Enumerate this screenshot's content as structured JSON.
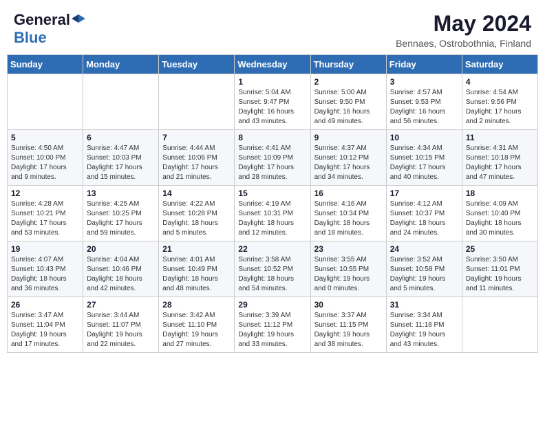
{
  "header": {
    "logo_general": "General",
    "logo_blue": "Blue",
    "title": "May 2024",
    "location": "Bennaes, Ostrobothnia, Finland"
  },
  "days_of_week": [
    "Sunday",
    "Monday",
    "Tuesday",
    "Wednesday",
    "Thursday",
    "Friday",
    "Saturday"
  ],
  "weeks": [
    [
      {
        "day": "",
        "info": ""
      },
      {
        "day": "",
        "info": ""
      },
      {
        "day": "",
        "info": ""
      },
      {
        "day": "1",
        "info": "Sunrise: 5:04 AM\nSunset: 9:47 PM\nDaylight: 16 hours\nand 43 minutes."
      },
      {
        "day": "2",
        "info": "Sunrise: 5:00 AM\nSunset: 9:50 PM\nDaylight: 16 hours\nand 49 minutes."
      },
      {
        "day": "3",
        "info": "Sunrise: 4:57 AM\nSunset: 9:53 PM\nDaylight: 16 hours\nand 56 minutes."
      },
      {
        "day": "4",
        "info": "Sunrise: 4:54 AM\nSunset: 9:56 PM\nDaylight: 17 hours\nand 2 minutes."
      }
    ],
    [
      {
        "day": "5",
        "info": "Sunrise: 4:50 AM\nSunset: 10:00 PM\nDaylight: 17 hours\nand 9 minutes."
      },
      {
        "day": "6",
        "info": "Sunrise: 4:47 AM\nSunset: 10:03 PM\nDaylight: 17 hours\nand 15 minutes."
      },
      {
        "day": "7",
        "info": "Sunrise: 4:44 AM\nSunset: 10:06 PM\nDaylight: 17 hours\nand 21 minutes."
      },
      {
        "day": "8",
        "info": "Sunrise: 4:41 AM\nSunset: 10:09 PM\nDaylight: 17 hours\nand 28 minutes."
      },
      {
        "day": "9",
        "info": "Sunrise: 4:37 AM\nSunset: 10:12 PM\nDaylight: 17 hours\nand 34 minutes."
      },
      {
        "day": "10",
        "info": "Sunrise: 4:34 AM\nSunset: 10:15 PM\nDaylight: 17 hours\nand 40 minutes."
      },
      {
        "day": "11",
        "info": "Sunrise: 4:31 AM\nSunset: 10:18 PM\nDaylight: 17 hours\nand 47 minutes."
      }
    ],
    [
      {
        "day": "12",
        "info": "Sunrise: 4:28 AM\nSunset: 10:21 PM\nDaylight: 17 hours\nand 53 minutes."
      },
      {
        "day": "13",
        "info": "Sunrise: 4:25 AM\nSunset: 10:25 PM\nDaylight: 17 hours\nand 59 minutes."
      },
      {
        "day": "14",
        "info": "Sunrise: 4:22 AM\nSunset: 10:28 PM\nDaylight: 18 hours\nand 5 minutes."
      },
      {
        "day": "15",
        "info": "Sunrise: 4:19 AM\nSunset: 10:31 PM\nDaylight: 18 hours\nand 12 minutes."
      },
      {
        "day": "16",
        "info": "Sunrise: 4:16 AM\nSunset: 10:34 PM\nDaylight: 18 hours\nand 18 minutes."
      },
      {
        "day": "17",
        "info": "Sunrise: 4:12 AM\nSunset: 10:37 PM\nDaylight: 18 hours\nand 24 minutes."
      },
      {
        "day": "18",
        "info": "Sunrise: 4:09 AM\nSunset: 10:40 PM\nDaylight: 18 hours\nand 30 minutes."
      }
    ],
    [
      {
        "day": "19",
        "info": "Sunrise: 4:07 AM\nSunset: 10:43 PM\nDaylight: 18 hours\nand 36 minutes."
      },
      {
        "day": "20",
        "info": "Sunrise: 4:04 AM\nSunset: 10:46 PM\nDaylight: 18 hours\nand 42 minutes."
      },
      {
        "day": "21",
        "info": "Sunrise: 4:01 AM\nSunset: 10:49 PM\nDaylight: 18 hours\nand 48 minutes."
      },
      {
        "day": "22",
        "info": "Sunrise: 3:58 AM\nSunset: 10:52 PM\nDaylight: 18 hours\nand 54 minutes."
      },
      {
        "day": "23",
        "info": "Sunrise: 3:55 AM\nSunset: 10:55 PM\nDaylight: 19 hours\nand 0 minutes."
      },
      {
        "day": "24",
        "info": "Sunrise: 3:52 AM\nSunset: 10:58 PM\nDaylight: 19 hours\nand 5 minutes."
      },
      {
        "day": "25",
        "info": "Sunrise: 3:50 AM\nSunset: 11:01 PM\nDaylight: 19 hours\nand 11 minutes."
      }
    ],
    [
      {
        "day": "26",
        "info": "Sunrise: 3:47 AM\nSunset: 11:04 PM\nDaylight: 19 hours\nand 17 minutes."
      },
      {
        "day": "27",
        "info": "Sunrise: 3:44 AM\nSunset: 11:07 PM\nDaylight: 19 hours\nand 22 minutes."
      },
      {
        "day": "28",
        "info": "Sunrise: 3:42 AM\nSunset: 11:10 PM\nDaylight: 19 hours\nand 27 minutes."
      },
      {
        "day": "29",
        "info": "Sunrise: 3:39 AM\nSunset: 11:12 PM\nDaylight: 19 hours\nand 33 minutes."
      },
      {
        "day": "30",
        "info": "Sunrise: 3:37 AM\nSunset: 11:15 PM\nDaylight: 19 hours\nand 38 minutes."
      },
      {
        "day": "31",
        "info": "Sunrise: 3:34 AM\nSunset: 11:18 PM\nDaylight: 19 hours\nand 43 minutes."
      },
      {
        "day": "",
        "info": ""
      }
    ]
  ]
}
